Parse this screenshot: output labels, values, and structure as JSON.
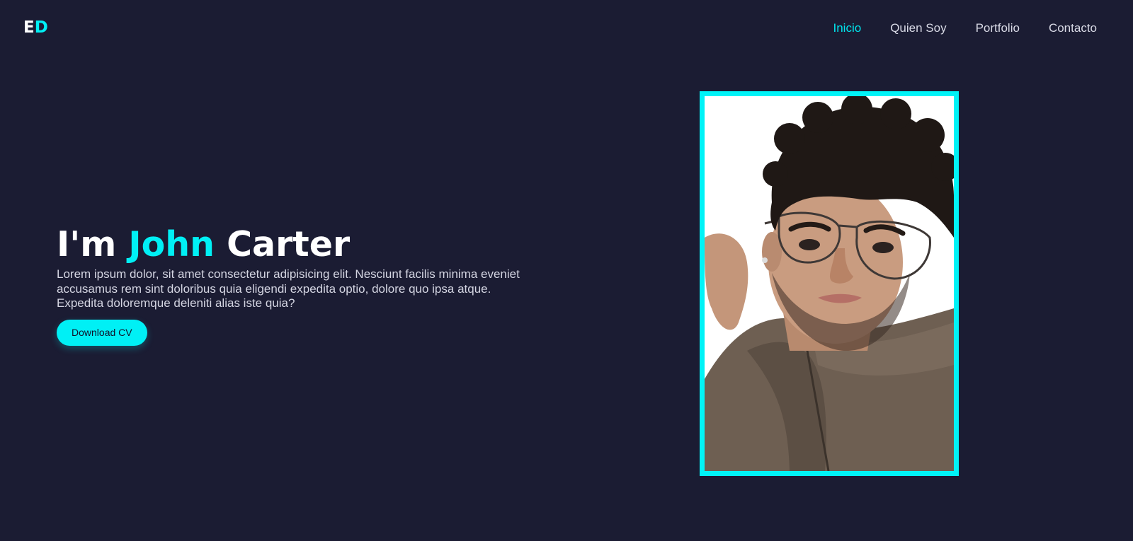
{
  "brand": {
    "logo_first": "E",
    "logo_second": "D"
  },
  "nav": {
    "items": [
      {
        "label": "Inicio",
        "active": true
      },
      {
        "label": "Quien Soy",
        "active": false
      },
      {
        "label": "Portfolio",
        "active": false
      },
      {
        "label": "Contacto",
        "active": false
      }
    ]
  },
  "hero": {
    "title_prefix": "I'm ",
    "title_highlight": "John",
    "title_suffix": " Carter",
    "description": "Lorem ipsum dolor, sit amet consectetur adipisicing elit. Nesciunt facilis minima eveniet accusamus rem sint doloribus quia eligendi expedita optio, dolore quo ipsa atque. Expedita doloremque deleniti alias iste quia?",
    "button_label": "Download CV"
  },
  "photo": {
    "subject": "portrait of a young man with curly hair and aviator glasses"
  },
  "colors": {
    "background": "#1b1c33",
    "accent": "#00f0f5",
    "text": "#ffffff"
  }
}
